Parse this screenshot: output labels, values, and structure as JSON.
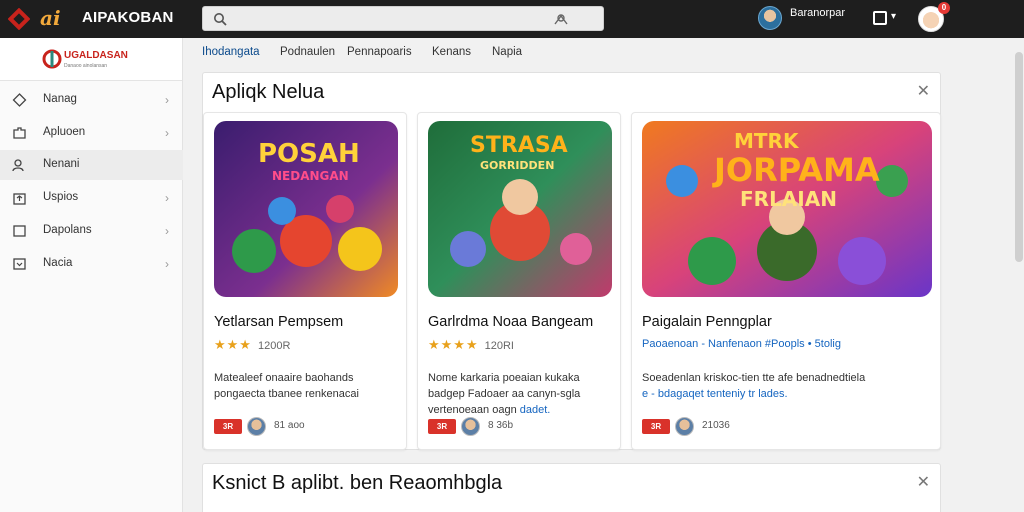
{
  "topbar": {
    "app_title": "AIPAKOBAN",
    "search_placeholder": "",
    "user_name": "Baranorpar",
    "user_sub": "",
    "notification_count": "0"
  },
  "sidebar": {
    "brand_name": "UGALDASAN",
    "brand_sub": "Danaoo ainolansan",
    "items": [
      {
        "label": "Nanag",
        "icon": "diamond-icon"
      },
      {
        "label": "Apluoen",
        "icon": "puzzle-icon"
      },
      {
        "label": "Nenani",
        "icon": "people-icon"
      },
      {
        "label": "Uspios",
        "icon": "upload-icon"
      },
      {
        "label": "Dapolans",
        "icon": "square-icon"
      },
      {
        "label": "Nacia",
        "icon": "download-box-icon"
      }
    ],
    "active_index": 2
  },
  "nav": {
    "tabs": [
      "Ihodangata",
      "Podnaulen",
      "Pennapoaris",
      "Kenans",
      "Napia"
    ],
    "active_index": 0
  },
  "section1": {
    "title": "Apliqk Nelua",
    "cards": [
      {
        "banner_text_1": "POSAH",
        "banner_text_2": "NEDANGAN",
        "title": "Yetlarsan Pempsem",
        "stars": "★★★",
        "rating_count": "1200R",
        "desc": "Matealeef onaaire baohands pongaecta tbanee renkenacai",
        "badge": "3R",
        "meta": "81 aoo"
      },
      {
        "banner_text_1": "STRASA",
        "banner_text_2": "GORRIDDEN",
        "title": "Garlrdma Noaa Bangeam",
        "stars": "★★★★",
        "rating_count": "120RI",
        "desc": "Nome karkaria poeaian kukaka badgep Fadoaer aa canyn-sgla vertenoeaan oagn",
        "desc_link": "dadet.",
        "badge": "3R",
        "meta": "8 36b"
      },
      {
        "banner_text_1": "MTRK",
        "banner_text_2": "JORPAMA",
        "banner_text_3": "FRLAIAN",
        "title": "Paigalain Penngplar",
        "tags": "Paoaenoan - Nanfenaon #Poopls • 5tolig",
        "desc": "Soeadenlan kriskoc-tien tte afe benadnedtiela",
        "desc_link_line": "e - bdagaqet tenteniy tr lades.",
        "badge": "3R",
        "meta": "21036"
      }
    ]
  },
  "section2": {
    "title": "Ksnict B aplibt. ben Reaomhbgla"
  },
  "colors": {
    "topbar_bg": "#1e1e1e",
    "accent_orange": "#f2a93b",
    "brand_red": "#c8231c",
    "link_blue": "#1565c0",
    "star_yellow": "#e8a11c",
    "badge_red": "#d9322a"
  }
}
